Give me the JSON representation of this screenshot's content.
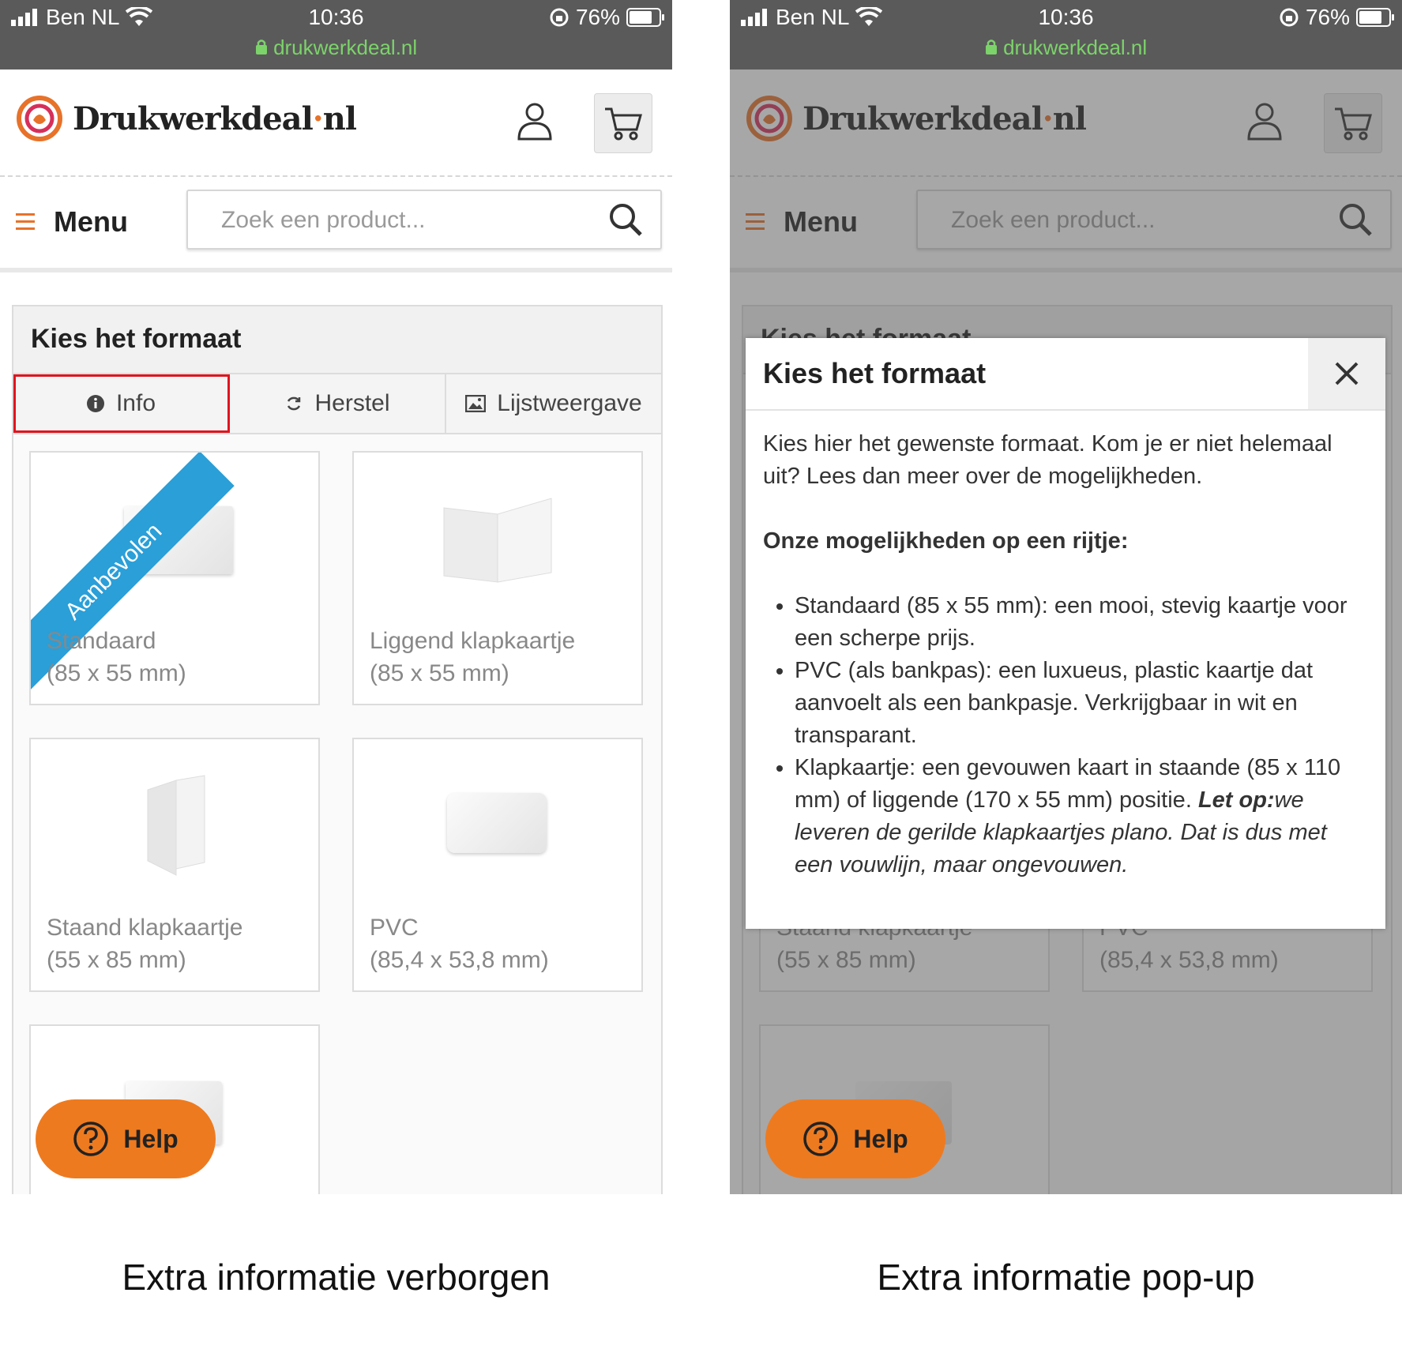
{
  "status_bar": {
    "carrier": "Ben NL",
    "time": "10:36",
    "battery": "76%",
    "url": "drukwerkdeal.nl"
  },
  "site": {
    "logo_text": "Drukwerkdeal",
    "logo_dot": "·",
    "logo_tld": "nl"
  },
  "nav": {
    "menu_label": "Menu",
    "search_placeholder": "Zoek een product..."
  },
  "panel": {
    "title": "Kies het formaat",
    "tabs": [
      {
        "label": "Info",
        "icon": "info-icon"
      },
      {
        "label": "Herstel",
        "icon": "refresh-icon"
      },
      {
        "label": "Lijstweergave",
        "icon": "image-icon"
      }
    ],
    "ribbon": "Aanbevolen",
    "products": [
      {
        "name": "Standaard",
        "size": "(85 x 55 mm)"
      },
      {
        "name": "Liggend klapkaartje",
        "size": "(85 x 55 mm)"
      },
      {
        "name": "Staand klapkaartje",
        "size": "(55 x 85 mm)"
      },
      {
        "name": "PVC",
        "size": "(85,4 x 53,8 mm)"
      }
    ]
  },
  "help_label": "Help",
  "modal": {
    "title": "Kies het formaat",
    "intro": "Kies hier het gewenste formaat. Kom je er niet helemaal uit? Lees dan meer over de mogelijkheden.",
    "subtitle": "Onze mogelijkheden op een rijtje:",
    "items": [
      "Standaard (85 x 55 mm): een mooi, stevig kaartje voor een scherpe prijs.",
      "PVC (als bankpas): een luxueus, plastic kaartje dat aanvoelt als een bankpasje. Verkrijgbaar in wit en transparant.",
      "Klapkaartje: een gevouwen kaart in staande (85 x 110 mm) of liggende (170 x 55 mm) positie."
    ],
    "note_bold": "Let op:",
    "note_italic": "we leveren de gerilde klapkaartjes plano. Dat is dus met een vouwlijn, maar ongevouwen."
  },
  "captions": {
    "left": "Extra informatie verborgen",
    "right": "Extra informatie pop-up"
  },
  "colors": {
    "accent": "#e7722a",
    "help": "#ee7a1f",
    "ribbon": "#2a9fd8",
    "highlight": "#e0141e",
    "url": "#7cd36a"
  }
}
